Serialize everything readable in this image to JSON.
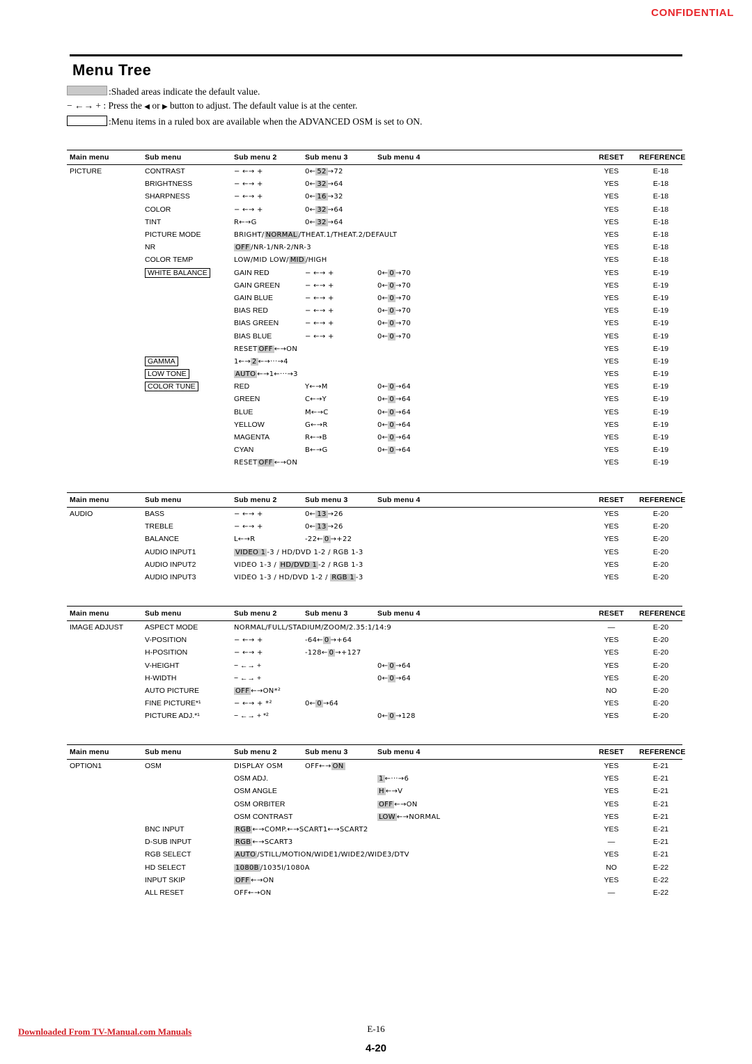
{
  "header": {
    "confidential": "CONFIDENTIAL"
  },
  "title": "Menu Tree",
  "legend": {
    "line1": ":Shaded areas indicate the default value.",
    "line2_a": "− ←→ + : Press the ",
    "line2_b": " or ",
    "line2_c": " button to adjust. The default value is at the center.",
    "line3": ":Menu items in a ruled box are available when the ADVANCED OSM is set to ON."
  },
  "columns": {
    "main": "Main menu",
    "sub": "Sub menu",
    "sub2": "Sub menu 2",
    "sub3": "Sub menu 3",
    "sub4": "Sub menu 4",
    "reset": "RESET",
    "reference": "REFERENCE"
  },
  "sections": [
    {
      "name": "picture",
      "rows": [
        {
          "main": "PICTURE",
          "sub": "CONTRAST",
          "sub2": "− ←→ +",
          "sub3": "0←",
          "val": "52",
          "tail": "→72",
          "reset": "YES",
          "ref": "E-18"
        },
        {
          "main": "",
          "sub": "BRIGHTNESS",
          "sub2": "− ←→ +",
          "sub3": "0←",
          "val": "32",
          "tail": "→64",
          "reset": "YES",
          "ref": "E-18"
        },
        {
          "main": "",
          "sub": "SHARPNESS",
          "sub2": "− ←→ +",
          "sub3": "0←",
          "val": "16",
          "tail": "→32",
          "reset": "YES",
          "ref": "E-18"
        },
        {
          "main": "",
          "sub": "COLOR",
          "sub2": "− ←→ +",
          "sub3": "0←",
          "val": "32",
          "tail": "→64",
          "reset": "YES",
          "ref": "E-18"
        },
        {
          "main": "",
          "sub": "TINT",
          "sub2": "R←→G",
          "sub3": "0←",
          "val": "32",
          "tail": "→64",
          "reset": "YES",
          "ref": "E-18"
        },
        {
          "main": "",
          "sub": "PICTURE MODE",
          "sub2": "BRIGHT/",
          "val": "NORMAL",
          "tail": "/THEAT.1/THEAT.2/DEFAULT",
          "reset": "YES",
          "ref": "E-18"
        },
        {
          "main": "",
          "sub": "NR",
          "sub2": "",
          "val": "OFF",
          "tail": "/NR-1/NR-2/NR-3",
          "reset": "YES",
          "ref": "E-18"
        },
        {
          "main": "",
          "sub": "COLOR TEMP",
          "sub2": "LOW/MID LOW/",
          "val": "MID",
          "tail": "/HIGH",
          "reset": "YES",
          "ref": "E-18"
        },
        {
          "main": "",
          "sub": "WHITE BALANCE",
          "subBoxed": true,
          "sub2": "GAIN RED",
          "sub3": "− ←→ +",
          "sub4pre": "0←",
          "val": "0",
          "tail": "→70",
          "reset": "YES",
          "ref": "E-19"
        },
        {
          "main": "",
          "sub": "",
          "sub2": "GAIN GREEN",
          "sub3": "− ←→ +",
          "sub4pre": "0←",
          "val": "0",
          "tail": "→70",
          "reset": "YES",
          "ref": "E-19"
        },
        {
          "main": "",
          "sub": "",
          "sub2": "GAIN BLUE",
          "sub3": "− ←→ +",
          "sub4pre": "0←",
          "val": "0",
          "tail": "→70",
          "reset": "YES",
          "ref": "E-19"
        },
        {
          "main": "",
          "sub": "",
          "sub2": "BIAS RED",
          "sub3": "− ←→ +",
          "sub4pre": "0←",
          "val": "0",
          "tail": "→70",
          "reset": "YES",
          "ref": "E-19"
        },
        {
          "main": "",
          "sub": "",
          "sub2": "BIAS GREEN",
          "sub3": "− ←→ +",
          "sub4pre": "0←",
          "val": "0",
          "tail": "→70",
          "reset": "YES",
          "ref": "E-19"
        },
        {
          "main": "",
          "sub": "",
          "sub2": "BIAS BLUE",
          "sub3": "− ←→ +",
          "sub4pre": "0←",
          "val": "0",
          "tail": "→70",
          "reset": "YES",
          "ref": "E-19"
        },
        {
          "main": "",
          "sub": "",
          "sub2": "RESET",
          "sub3": "",
          "val": "OFF",
          "tail": "←→ON",
          "reset": "YES",
          "ref": "E-19"
        },
        {
          "main": "",
          "sub": "GAMMA",
          "subBoxed": true,
          "sub2": "1←→",
          "val": "2",
          "tail": "←→···→4",
          "reset": "YES",
          "ref": "E-19"
        },
        {
          "main": "",
          "sub": "LOW TONE",
          "subBoxed": true,
          "sub2": "",
          "val": "AUTO",
          "tail": "←→1←···→3",
          "reset": "YES",
          "ref": "E-19"
        },
        {
          "main": "",
          "sub": "COLOR TUNE",
          "subBoxed": true,
          "sub2": "RED",
          "sub3": "Y←→M",
          "sub4pre": "0←",
          "val": "0",
          "tail": "→64",
          "reset": "YES",
          "ref": "E-19"
        },
        {
          "main": "",
          "sub": "",
          "sub2": "GREEN",
          "sub3": "C←→Y",
          "sub4pre": "0←",
          "val": "0",
          "tail": "→64",
          "reset": "YES",
          "ref": "E-19"
        },
        {
          "main": "",
          "sub": "",
          "sub2": "BLUE",
          "sub3": "M←→C",
          "sub4pre": "0←",
          "val": "0",
          "tail": "→64",
          "reset": "YES",
          "ref": "E-19"
        },
        {
          "main": "",
          "sub": "",
          "sub2": "YELLOW",
          "sub3": "G←→R",
          "sub4pre": "0←",
          "val": "0",
          "tail": "→64",
          "reset": "YES",
          "ref": "E-19"
        },
        {
          "main": "",
          "sub": "",
          "sub2": "MAGENTA",
          "sub3": "R←→B",
          "sub4pre": "0←",
          "val": "0",
          "tail": "→64",
          "reset": "YES",
          "ref": "E-19"
        },
        {
          "main": "",
          "sub": "",
          "sub2": "CYAN",
          "sub3": "B←→G",
          "sub4pre": "0←",
          "val": "0",
          "tail": "→64",
          "reset": "YES",
          "ref": "E-19"
        },
        {
          "main": "",
          "sub": "",
          "sub2": "RESET",
          "sub3": "",
          "val": "OFF",
          "tail": "←→ON",
          "reset": "YES",
          "ref": "E-19"
        }
      ]
    },
    {
      "name": "audio",
      "rows": [
        {
          "main": "AUDIO",
          "sub": "BASS",
          "sub2": "− ←→ +",
          "sub3": "0←",
          "val": "13",
          "tail": "→26",
          "reset": "YES",
          "ref": "E-20"
        },
        {
          "main": "",
          "sub": "TREBLE",
          "sub2": "− ←→ +",
          "sub3": "0←",
          "val": "13",
          "tail": "→26",
          "reset": "YES",
          "ref": "E-20"
        },
        {
          "main": "",
          "sub": "BALANCE",
          "sub2": "L←→R",
          "sub3": "-22←",
          "val": "0",
          "tail": "→+22",
          "reset": "YES",
          "ref": "E-20"
        },
        {
          "main": "",
          "sub": "AUDIO INPUT1",
          "sub2": "",
          "val": "VIDEO 1",
          "tail": "-3 / HD/DVD 1-2 / RGB 1-3",
          "reset": "YES",
          "ref": "E-20"
        },
        {
          "main": "",
          "sub": "AUDIO INPUT2",
          "sub2": "VIDEO 1-3 / ",
          "val": "HD/DVD 1",
          "tail": "-2 / RGB 1-3",
          "reset": "YES",
          "ref": "E-20"
        },
        {
          "main": "",
          "sub": "AUDIO INPUT3",
          "sub2": "VIDEO 1-3 / HD/DVD 1-2 / ",
          "val": "RGB 1",
          "tail": "-3",
          "reset": "YES",
          "ref": "E-20"
        }
      ]
    },
    {
      "name": "image-adjust",
      "rows": [
        {
          "main": "IMAGE ADJUST",
          "sub": "ASPECT MODE",
          "sub2": "NORMAL/FULL/STADIUM/ZOOM/2.35:1/14:9",
          "reset": "—",
          "ref": "E-20"
        },
        {
          "main": "",
          "sub": "V-POSITION",
          "sub2": "− ←→ +",
          "sub3": "-64←",
          "val": "0",
          "tail": "→+64",
          "reset": "YES",
          "ref": "E-20"
        },
        {
          "main": "",
          "sub": "H-POSITION",
          "sub2": "− ←→ +",
          "sub3": "-128←",
          "val": "0",
          "tail": "→+127",
          "reset": "YES",
          "ref": "E-20"
        },
        {
          "main": "",
          "sub": "V-HEIGHT",
          "sub2": "− ←→ +",
          "sub3": "",
          "sub4pre": "0←",
          "val": "0",
          "tail": "→64",
          "reset": "YES",
          "ref": "E-20"
        },
        {
          "main": "",
          "sub": "H-WIDTH",
          "sub2": "− ←→ +",
          "sub3": "",
          "sub4pre": "0←",
          "val": "0",
          "tail": "→64",
          "reset": "YES",
          "ref": "E-20"
        },
        {
          "main": "",
          "sub": "AUTO PICTURE",
          "sub2": "",
          "val": "OFF",
          "tail": "←→ON*²",
          "reset": "NO",
          "ref": "E-20"
        },
        {
          "main": "",
          "sub": "FINE PICTURE*¹",
          "sub2": "− ←→ + *²",
          "sub3": "0←",
          "val": "0",
          "tail": "→64",
          "reset": "YES",
          "ref": "E-20"
        },
        {
          "main": "",
          "sub": "PICTURE ADJ.*¹",
          "sub2": "− ←→ + *²",
          "sub3": "",
          "sub4pre": "0←",
          "val": "0",
          "tail": "→128",
          "reset": "YES",
          "ref": "E-20"
        }
      ]
    },
    {
      "name": "option1",
      "rows": [
        {
          "main": "OPTION1",
          "sub": "OSM",
          "sub2": "DISPLAY OSM",
          "sub3": "OFF←→",
          "val": "ON",
          "tail": "",
          "reset": "YES",
          "ref": "E-21"
        },
        {
          "main": "",
          "sub": "",
          "sub2": "OSM ADJ.",
          "sub3": "",
          "sub4pre": "",
          "val": "1",
          "tail": "←···→6",
          "reset": "YES",
          "ref": "E-21"
        },
        {
          "main": "",
          "sub": "",
          "sub2": "OSM ANGLE",
          "sub3": "",
          "sub4pre": "",
          "val": "H",
          "tail": "←→V",
          "reset": "YES",
          "ref": "E-21"
        },
        {
          "main": "",
          "sub": "",
          "sub2": "OSM ORBITER",
          "sub3": "",
          "sub4pre": "",
          "val": "OFF",
          "tail": "←→ON",
          "reset": "YES",
          "ref": "E-21"
        },
        {
          "main": "",
          "sub": "",
          "sub2": "OSM CONTRAST",
          "sub3": "",
          "sub4pre": "",
          "val": "LOW",
          "tail": "←→NORMAL",
          "reset": "YES",
          "ref": "E-21"
        },
        {
          "main": "",
          "sub": "BNC INPUT",
          "sub2": "",
          "val": "RGB",
          "tail": "←→COMP.←→SCART1←→SCART2",
          "reset": "YES",
          "ref": "E-21"
        },
        {
          "main": "",
          "sub": "D-SUB INPUT",
          "sub2": "",
          "val": "RGB",
          "tail": "←→SCART3",
          "reset": "—",
          "ref": "E-21"
        },
        {
          "main": "",
          "sub": "RGB SELECT",
          "sub2": "",
          "val": "AUTO",
          "tail": "/STILL/MOTION/WIDE1/WIDE2/WIDE3/DTV",
          "reset": "YES",
          "ref": "E-21"
        },
        {
          "main": "",
          "sub": "HD SELECT",
          "sub2": "",
          "val": "1080B",
          "tail": "/1035I/1080A",
          "reset": "NO",
          "ref": "E-22"
        },
        {
          "main": "",
          "sub": "INPUT SKIP",
          "sub2": "",
          "val": "OFF",
          "tail": "←→ON",
          "reset": "YES",
          "ref": "E-22"
        },
        {
          "main": "",
          "sub": "ALL RESET",
          "sub2": "OFF←→ON",
          "val": "",
          "tail": "",
          "reset": "—",
          "ref": "E-22"
        }
      ]
    }
  ],
  "footer": {
    "download_link": "Downloaded From TV-Manual.com Manuals",
    "page_label": "E-16",
    "page_number": "4-20"
  }
}
